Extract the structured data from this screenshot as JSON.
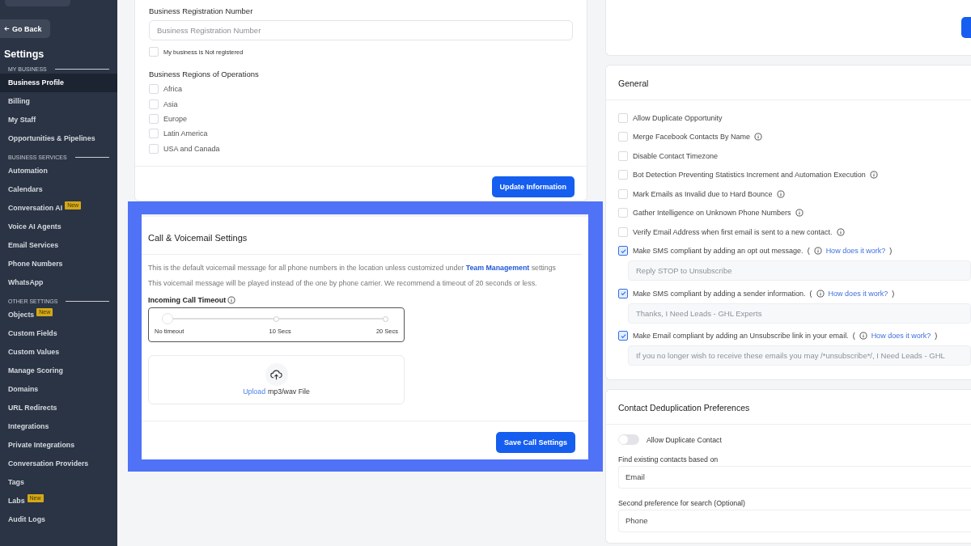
{
  "sidebar": {
    "back_button": "Go Back",
    "title": "Settings",
    "sections": [
      {
        "heading": "MY BUSINESS",
        "items": [
          {
            "label": "Business Profile",
            "selected": true
          },
          {
            "label": "Billing",
            "selected": false
          },
          {
            "label": "My Staff",
            "selected": false
          },
          {
            "label": "Opportunities & Pipelines",
            "selected": false
          }
        ]
      },
      {
        "heading": "BUSINESS SERVICES",
        "items": [
          {
            "label": "Automation",
            "selected": false
          },
          {
            "label": "Calendars",
            "selected": false
          },
          {
            "label": "Conversation AI",
            "selected": false,
            "badge": "New"
          },
          {
            "label": "Voice AI Agents",
            "selected": false
          },
          {
            "label": "Email Services",
            "selected": false
          },
          {
            "label": "Phone Numbers",
            "selected": false
          },
          {
            "label": "WhatsApp",
            "selected": false
          }
        ]
      },
      {
        "heading": "OTHER SETTINGS",
        "items": [
          {
            "label": "Objects",
            "selected": false,
            "badge": "New"
          },
          {
            "label": "Custom Fields",
            "selected": false
          },
          {
            "label": "Custom Values",
            "selected": false
          },
          {
            "label": "Manage Scoring",
            "selected": false
          },
          {
            "label": "Domains",
            "selected": false
          },
          {
            "label": "URL Redirects",
            "selected": false
          },
          {
            "label": "Integrations",
            "selected": false
          },
          {
            "label": "Private Integrations",
            "selected": false
          },
          {
            "label": "Conversation Providers",
            "selected": false
          },
          {
            "label": "Tags",
            "selected": false
          },
          {
            "label": "Labs",
            "selected": false,
            "badge": "New"
          },
          {
            "label": "Audit Logs",
            "selected": false
          }
        ]
      }
    ]
  },
  "business_info": {
    "registration": {
      "label": "Business Registration Number",
      "placeholder": "Business Registration Number"
    },
    "not_registered": {
      "label": "My business is Not registered",
      "checked": false
    },
    "regions": {
      "label": "Business Regions of Operations",
      "options": [
        {
          "label": "Africa",
          "checked": false
        },
        {
          "label": "Asia",
          "checked": false
        },
        {
          "label": "Europe",
          "checked": false
        },
        {
          "label": "Latin America",
          "checked": false
        },
        {
          "label": "USA and Canada",
          "checked": false
        }
      ]
    },
    "update_button": "Update Information"
  },
  "call_settings": {
    "title": "Call & Voicemail Settings",
    "description": {
      "text": "This is the default voicemail message for all phone numbers in the location unless customized under",
      "link": "Team Management",
      "after": "settings"
    },
    "note": "This voicemail message will be played instead of the one by phone carrier. We recommend a timeout of 20 seconds or less.",
    "timeout": {
      "label": "Incoming Call Timeout",
      "level": 0,
      "ticks": [
        "No timeout",
        "10 Secs",
        "20 Secs"
      ]
    },
    "upload": {
      "link": "Upload",
      "text": "mp3/wav File"
    },
    "save_button": "Save Call Settings"
  },
  "general": {
    "title": "General",
    "options": [
      {
        "label": "Allow Duplicate Opportunity",
        "checked": false,
        "info": false
      },
      {
        "label": "Merge Facebook Contacts By Name",
        "checked": false,
        "info": true
      },
      {
        "label": "Disable Contact Timezone",
        "checked": false,
        "info": false
      },
      {
        "label": "Bot Detection Preventing Statistics Increment and Automation Execution",
        "checked": false,
        "info": true
      },
      {
        "label": "Mark Emails as Invalid due to Hard Bounce",
        "checked": false,
        "info": true
      },
      {
        "label": "Gather Intelligence on Unknown Phone Numbers",
        "checked": false,
        "info": true
      },
      {
        "label": "Verify Email Address when first email is sent to a new contact.",
        "checked": false,
        "info": true
      },
      {
        "label": "Make SMS compliant by adding an opt out message.",
        "checked": true,
        "info": true,
        "help": {
          "open": "(",
          "link": "How does it work?",
          "close": ")"
        },
        "field": {
          "placeholder": "Reply STOP to Unsubscribe"
        }
      },
      {
        "label": "Make SMS compliant by adding a sender information.",
        "checked": true,
        "info": true,
        "help": {
          "open": "(",
          "link": "How does it work?",
          "close": ")"
        },
        "field": {
          "placeholder": "Thanks, I Need Leads - GHL Experts"
        }
      },
      {
        "label": "Make Email compliant by adding an Unsubscribe link in your email.",
        "checked": true,
        "info": true,
        "help": {
          "open": "(",
          "link": "How does it work?",
          "close": ")"
        },
        "field": {
          "placeholder": "If you no longer wish to receive these emails you may /*unsubscribe*/, I Need Leads - GHL"
        }
      }
    ]
  },
  "deduplication": {
    "title": "Contact Deduplication Preferences",
    "toggle": {
      "label": "Allow Duplicate Contact",
      "on": false
    },
    "selects": [
      {
        "label": "Find existing contacts based on",
        "value": "Email"
      },
      {
        "label": "Second preference for search (Optional)",
        "value": "Phone"
      }
    ]
  }
}
